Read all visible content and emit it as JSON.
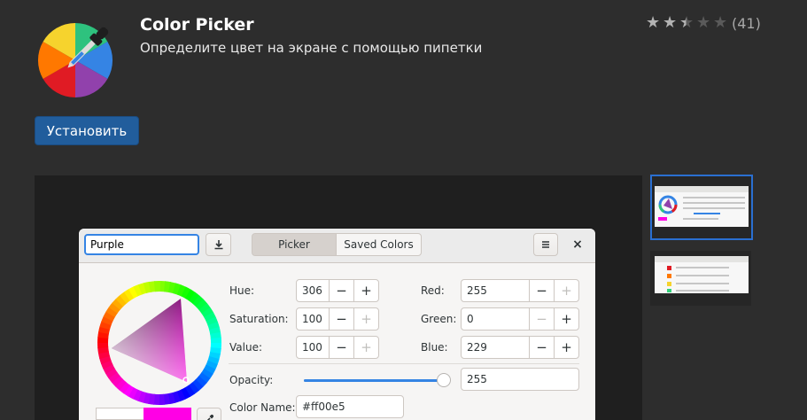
{
  "app": {
    "title": "Color Picker",
    "subtitle": "Определите цвет на экране с помощью пипетки",
    "icon": "color-picker-app-icon",
    "rating_stars": 2.5,
    "rating_max": 5,
    "rating_count": "(41)",
    "install_label": "Установить"
  },
  "screenshot": {
    "name_entry": "Purple",
    "tabs": [
      "Picker",
      "Saved Colors"
    ],
    "active_tab": "Picker",
    "hue_label": "Hue:",
    "hue_value": "306",
    "saturation_label": "Saturation:",
    "saturation_value": "100",
    "value_label": "Value:",
    "value_value": "100",
    "red_label": "Red:",
    "red_value": "255",
    "green_label": "Green:",
    "green_value": "0",
    "blue_label": "Blue:",
    "blue_value": "229",
    "opacity_label": "Opacity:",
    "opacity_value": "255",
    "opacity_fraction": 1.0,
    "color_name_label": "Color Name:",
    "color_name_value": "#ff00e5",
    "minus": "−",
    "plus": "+",
    "close": "×",
    "current_color": "#ff00e5",
    "previous_color": "#ffffff"
  },
  "colors": {
    "background": "#2d2d2d",
    "install_button": "#215d9c",
    "selected_thumb_border": "#2a6fd1",
    "accent": "#3584e4"
  }
}
